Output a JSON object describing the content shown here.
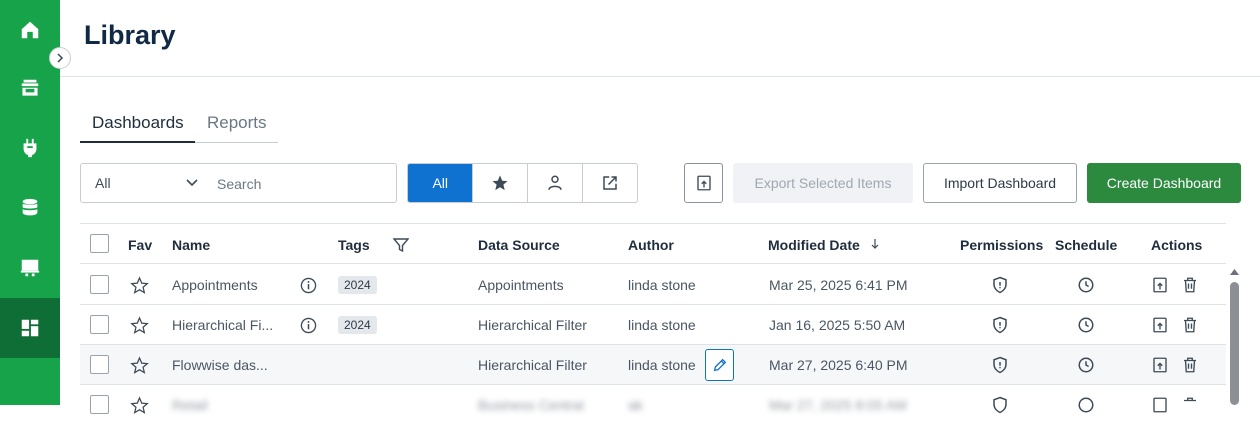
{
  "page": {
    "title": "Library"
  },
  "sidebar": {
    "items": [
      {
        "name": "home",
        "icon": "home-icon",
        "active": false
      },
      {
        "name": "inbox",
        "icon": "archive-icon",
        "active": false
      },
      {
        "name": "connections",
        "icon": "plug-icon",
        "active": false
      },
      {
        "name": "data",
        "icon": "database-icon",
        "active": false
      },
      {
        "name": "presentations",
        "icon": "presentation-icon",
        "active": false
      },
      {
        "name": "library",
        "icon": "dashboard-icon",
        "active": true
      }
    ],
    "collapse_icon": "chevron-right-icon"
  },
  "tabs": [
    {
      "label": "Dashboards",
      "active": true
    },
    {
      "label": "Reports",
      "active": false
    }
  ],
  "search": {
    "filter_value": "All",
    "placeholder": "Search"
  },
  "filters": [
    {
      "label": "All",
      "icon": "",
      "active": true
    },
    {
      "label": "",
      "icon": "star-icon",
      "active": false
    },
    {
      "label": "",
      "icon": "user-icon",
      "active": false
    },
    {
      "label": "",
      "icon": "share-icon",
      "active": false
    }
  ],
  "toolbar": {
    "export_selected": "Export Selected Items",
    "import": "Import Dashboard",
    "create": "Create Dashboard"
  },
  "table": {
    "headers": {
      "fav": "Fav",
      "name": "Name",
      "tags": "Tags",
      "data_source": "Data Source",
      "author": "Author",
      "modified": "Modified Date",
      "permissions": "Permissions",
      "schedule": "Schedule",
      "actions": "Actions"
    },
    "rows": [
      {
        "name": "Appointments",
        "has_info": true,
        "tag": "2024",
        "data_source": "Appointments",
        "author": "linda stone",
        "modified": "Mar 25, 2025 6:41 PM"
      },
      {
        "name": "Hierarchical Fi...",
        "has_info": true,
        "tag": "2024",
        "data_source": "Hierarchical Filter",
        "author": "linda stone",
        "modified": "Jan 16, 2025 5:50 AM"
      },
      {
        "name": "Flowwise das...",
        "has_info": false,
        "tag": "",
        "data_source": "Hierarchical Filter",
        "author": "linda stone",
        "modified": "Mar 27, 2025 6:40 PM"
      },
      {
        "name": "Retail",
        "has_info": false,
        "tag": "",
        "data_source": "Business Central",
        "author": "ak",
        "modified": "Mar 27, 2025 8:05 AM"
      }
    ]
  },
  "colors": {
    "sidebar": "#17a34a",
    "sidebar_active": "#0f6e35",
    "primary": "#0f72d1",
    "create": "#2b8a3e"
  }
}
